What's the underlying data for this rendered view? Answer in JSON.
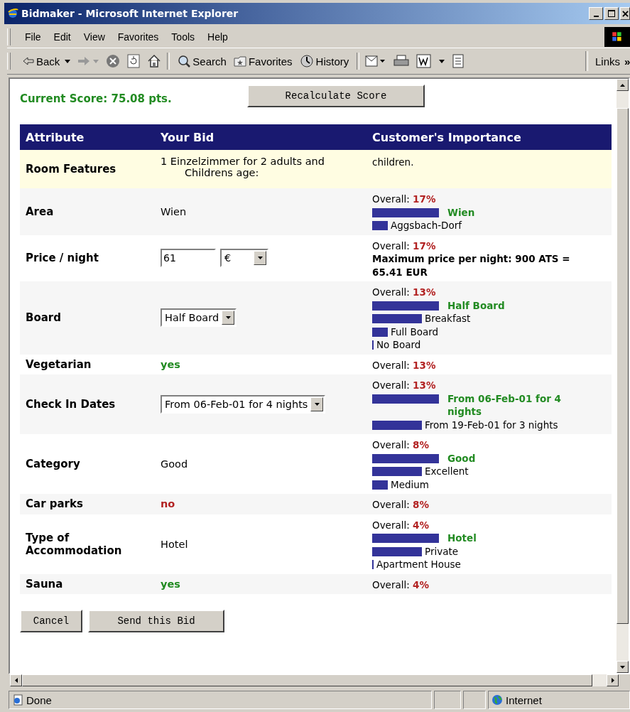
{
  "window": {
    "title": "Bidmaker - Microsoft Internet Explorer"
  },
  "menu": [
    "File",
    "Edit",
    "View",
    "Favorites",
    "Tools",
    "Help"
  ],
  "toolbar": {
    "back": "Back",
    "buttons": [
      "Search",
      "Favorites",
      "History"
    ],
    "links": "Links",
    "more": "»"
  },
  "score": {
    "label": "Current Score: 75.08 pts.",
    "button": "Recalculate Score"
  },
  "table": {
    "columns": [
      "Attribute",
      "Your Bid",
      "Customer's Importance"
    ],
    "rows": [
      {
        "kind": "features",
        "attribute": "Room Features",
        "bid": {
          "kind": "lines",
          "lines": [
            "1 Einzelzimmer for 2 adults and",
            "Childrens age:"
          ]
        },
        "importance": {
          "note": "children."
        }
      },
      {
        "kind": "attribute",
        "attribute": "Area",
        "bid": {
          "kind": "text",
          "value": "Wien"
        },
        "importance": {
          "label": "Overall:",
          "overall": "17%",
          "options": [
            {
              "label": "Wien",
              "kind": "long",
              "highlighted": true
            },
            {
              "label": "Aggsbach-Dorf",
              "kind": "short",
              "highlighted": false
            }
          ]
        }
      },
      {
        "kind": "attribute",
        "attribute": "Price / night",
        "bid": {
          "kind": "price",
          "value": "61",
          "currency": "€"
        },
        "importance": {
          "label": "Overall:",
          "overall": "17%",
          "detail": "Maximum price per night: 900 ATS = 65.41 EUR"
        }
      },
      {
        "kind": "attribute",
        "attribute": "Board",
        "bid": {
          "kind": "select",
          "value": "Half Board"
        },
        "importance": {
          "label": "Overall:",
          "overall": "13%",
          "options": [
            {
              "label": "Half Board",
              "kind": "long",
              "highlighted": true
            },
            {
              "label": "Breakfast",
              "kind": "medium",
              "highlighted": false
            },
            {
              "label": "Full Board",
              "kind": "short",
              "highlighted": false
            },
            {
              "label": "No Board",
              "kind": "minimal",
              "highlighted": false
            }
          ]
        }
      },
      {
        "kind": "attribute",
        "attribute": "Vegetarian",
        "bid": {
          "kind": "flag",
          "value": "yes",
          "positive": true
        },
        "importance": {
          "label": "Overall:",
          "overall": "13%"
        }
      },
      {
        "kind": "attribute",
        "attribute": "Check In Dates",
        "bid": {
          "kind": "select",
          "value": "From 06-Feb-01 for 4 nights"
        },
        "importance": {
          "label": "Overall:",
          "overall": "13%",
          "options": [
            {
              "label": "From 06-Feb-01 for 4 nights",
              "kind": "long",
              "highlighted": true
            },
            {
              "label": "From 19-Feb-01 for 3 nights",
              "kind": "medium",
              "highlighted": false
            }
          ]
        }
      },
      {
        "kind": "attribute",
        "attribute": "Category",
        "bid": {
          "kind": "text",
          "value": "Good"
        },
        "importance": {
          "label": "Overall:",
          "overall": "8%",
          "options": [
            {
              "label": "Good",
              "kind": "long",
              "highlighted": true
            },
            {
              "label": "Excellent",
              "kind": "medium",
              "highlighted": false
            },
            {
              "label": "Medium",
              "kind": "short",
              "highlighted": false
            }
          ]
        }
      },
      {
        "kind": "attribute",
        "attribute": "Car parks",
        "bid": {
          "kind": "flag",
          "value": "no",
          "positive": false
        },
        "importance": {
          "label": "Overall:",
          "overall": "8%"
        }
      },
      {
        "kind": "attribute",
        "attribute": "Type of Accommodation",
        "bid": {
          "kind": "text",
          "value": "Hotel"
        },
        "importance": {
          "label": "Overall:",
          "overall": "4%",
          "options": [
            {
              "label": "Hotel",
              "kind": "long",
              "highlighted": true
            },
            {
              "label": "Private",
              "kind": "medium",
              "highlighted": false
            },
            {
              "label": "Apartment House",
              "kind": "minimal",
              "highlighted": false
            }
          ]
        }
      },
      {
        "kind": "attribute",
        "attribute": "Sauna",
        "bid": {
          "kind": "flag",
          "value": "yes",
          "positive": true
        },
        "importance": {
          "label": "Overall:",
          "overall": "4%"
        }
      }
    ]
  },
  "buttons": [
    "Cancel",
    "Send this Bid"
  ],
  "status_bar": {
    "text": "Done",
    "zone": "Internet"
  }
}
